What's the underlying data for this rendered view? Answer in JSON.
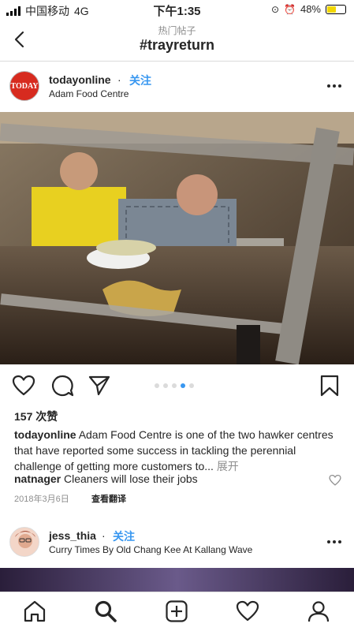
{
  "status_bar": {
    "carrier": "中国移动",
    "network": "4G",
    "time": "下午1:35",
    "battery": "48%",
    "battery_level": 0.48
  },
  "nav": {
    "subtitle": "热门帖子",
    "title": "#trayreturn"
  },
  "post": {
    "username": "todayonline",
    "separator": "·",
    "follow_label": "关注",
    "location": "Adam Food Centre",
    "avatar_text": "TODAY",
    "likes": "157 次赞",
    "caption_user": "todayonline",
    "caption_text": "Adam Food Centre is one of the two hawker centres that have reported some success in tackling the perennial challenge of getting more customers to...",
    "caption_more": "展开",
    "comment_user": "natnager",
    "comment_text": "Cleaners will lose their jobs",
    "date": "2018年3月6日",
    "translate": "查看翻译",
    "carousel": {
      "count": 5,
      "active": 3
    }
  },
  "post2": {
    "username": "jess_thia",
    "separator": "·",
    "follow_label": "关注",
    "location": "Curry Times By Old Chang Kee At Kallang Wave"
  },
  "icons": [
    "back-icon",
    "more-icon",
    "heart-icon",
    "comment-icon",
    "share-icon",
    "bookmark-icon",
    "home-icon",
    "search-icon",
    "add-icon",
    "activity-icon",
    "profile-icon"
  ],
  "colors": {
    "accent": "#3897f0",
    "brand_today": "#d72b1f"
  }
}
